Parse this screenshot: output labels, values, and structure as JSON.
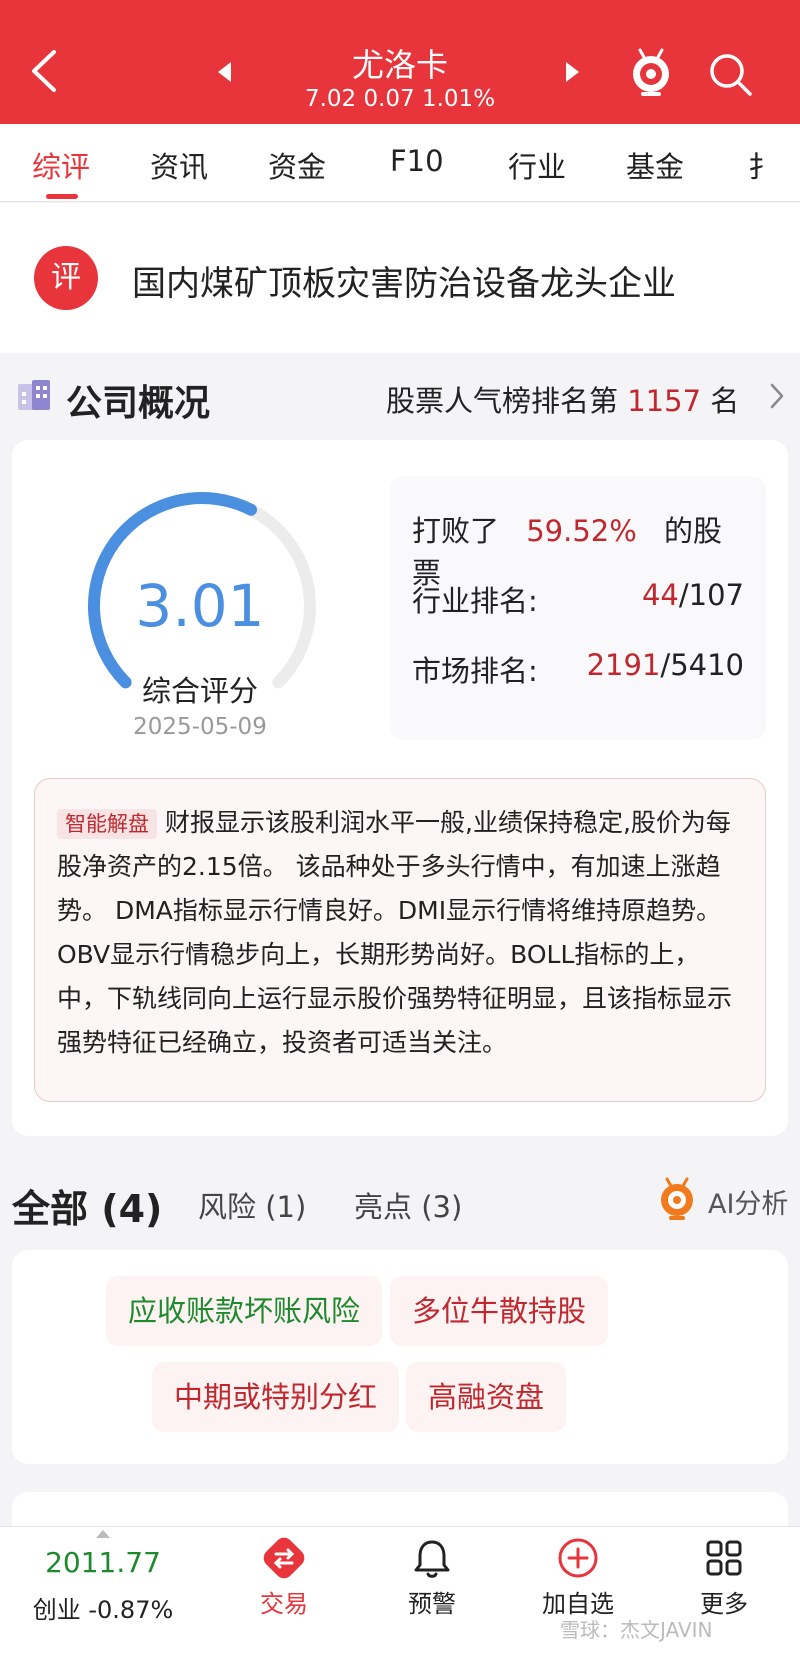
{
  "header": {
    "title": "尤洛卡",
    "quote": "7.02 0.07 1.01%",
    "colors": {
      "brand": "#e8343b"
    },
    "icons": [
      "back-chevron-icon",
      "prev-stock-icon",
      "next-stock-icon",
      "robot-assistant-icon",
      "search-icon"
    ]
  },
  "tabs": [
    "综评",
    "资讯",
    "资金",
    "F10",
    "行业",
    "基金",
    "扌"
  ],
  "active_tab": "综评",
  "banner": {
    "badge": "评",
    "headline": "国内煤矿顶板灾害防治设备龙头企业"
  },
  "overview": {
    "title": "公司概况",
    "rank_prefix": "股票人气榜排名第",
    "rank_number": "1157",
    "rank_suffix": "名"
  },
  "score": {
    "value": "3.01",
    "label": "综合评分",
    "date": "2025-05-09",
    "gauge_fraction": 0.6,
    "colors": {
      "arc": "#4a8fe0",
      "track": "#ececec"
    }
  },
  "stats": {
    "beat_prefix": "打败了",
    "beat_pct": "59.52%",
    "beat_suffix": "的股票",
    "industry_label": "行业排名:",
    "industry_rank": "44",
    "industry_total": "/107",
    "market_label": "市场排名:",
    "market_rank": "2191",
    "market_total": "/5410"
  },
  "analysis": {
    "tag": "智能解盘",
    "text": "财报显示该股利润水平一般,业绩保持稳定,股价为每股净资产的2.15倍。 该品种处于多头行情中，有加速上涨趋势。 DMA指标显示行情良好。DMI显示行情将维持原趋势。OBV显示行情稳步向上，长期形势尚好。BOLL指标的上，中，下轨线同向上运行显示股价强势特征明显，且该指标显示强势特征已经确立，投资者可适当关注。"
  },
  "filters": {
    "all": "全部 (4)",
    "risk": "风险 (1)",
    "highlight": "亮点 (3)",
    "ai": "AI分析"
  },
  "tags": [
    {
      "label": "应收账款坏账风险",
      "kind": "risk"
    },
    {
      "label": "多位牛散持股",
      "kind": "highlight"
    },
    {
      "label": "中期或特别分红",
      "kind": "highlight"
    },
    {
      "label": "高融资盘",
      "kind": "highlight"
    }
  ],
  "bottom_nav": {
    "index_value": "2011.77",
    "index_name": "创业 -0.87%",
    "items": [
      "交易",
      "预警",
      "加自选",
      "更多"
    ]
  },
  "watermark": "雪球：杰文JAVIN"
}
